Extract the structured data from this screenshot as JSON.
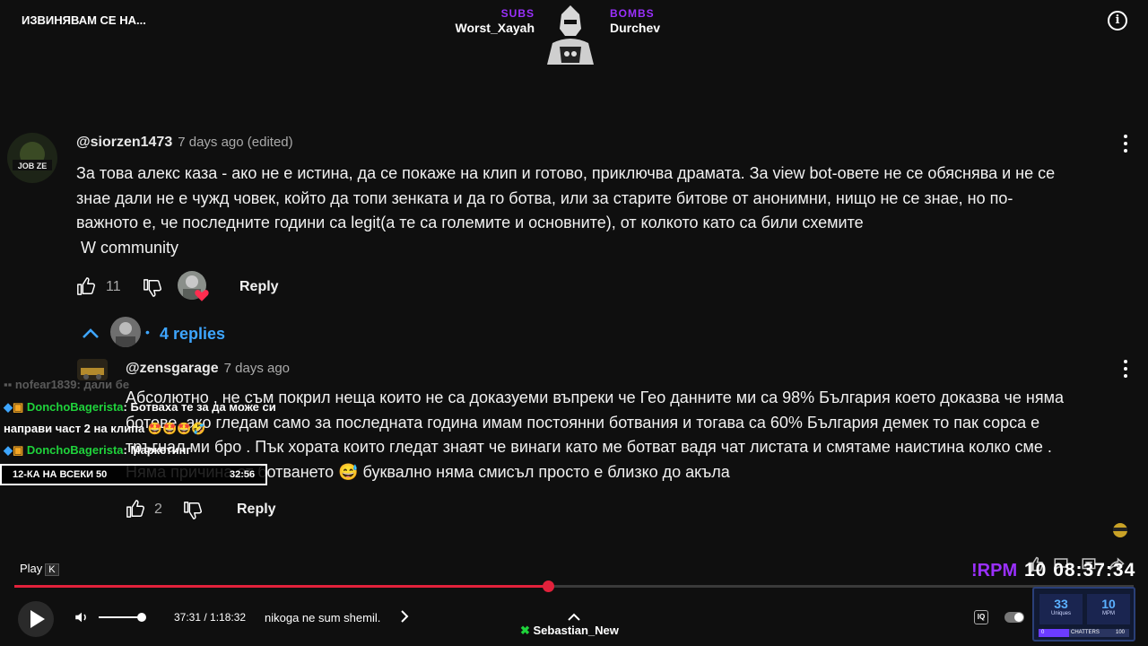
{
  "overlay": {
    "stream_title": "ИЗВИНЯВАМ СЕ НА...",
    "subs_label": "SUBS",
    "subs_name": "Worst_Xayah",
    "bombs_label": "BOMBS",
    "bombs_name": "Durchev",
    "rpm_label": "!RPM",
    "clock": "10 08:37:34",
    "box_label": "12-КА НА ВСЕКИ 50",
    "box_value": "32:56",
    "colors": {
      "accent_purple": "#9b30ff",
      "chat_green": "#1fd33b",
      "progress_red": "#e2213b",
      "link_blue": "#3ea6ff"
    }
  },
  "comments": [
    {
      "author": "@siorzen1473",
      "time": "7 days ago (edited)",
      "avatar_text": "JOB ZE",
      "lines": [
        "За това алекс каза - ако не е истина, да се покаже на клип и готово, приключва драмата. За view bot-овете не се обяснява и не се",
        "знае дали не е чужд човек, който да топи зенката и да го ботва, или за старите битове от анонимни, нищо не се знае, но по-",
        "важното е, че последните години са legit(а те са големите и основните), от колкото като са били схемите",
        " W community"
      ],
      "likes": "11",
      "reply_label": "Reply",
      "replies_label": "4 replies"
    },
    {
      "author": "@zensgarage",
      "time": "7 days ago",
      "lines": [
        "Абсолютно , не съм покрил неща които не са доказуеми въпреки че Гео данните ми са 98% България което доказва че няма",
        "ботове. ако гледам само за последната година имам постоянни ботвания и тогава са 60% България демек то пак сорса е",
        "тръгнал ми брo . Пък хората които гледат знаят че винаги като ме ботват вадя чат листата  и смятаме наистина колко сме .",
        "Няма причина от ботването 😅 буквално няма смисъл просто е близко до акъла"
      ],
      "likes": "2",
      "reply_label": "Reply"
    }
  ],
  "chat": [
    {
      "user": "nofear1839",
      "text": ": дали бе",
      "faded": true
    },
    {
      "user": "DonchoBagerista",
      "text": ": Ботваха те за да може си",
      "faded": false
    },
    {
      "user": "",
      "text": "направи част 2 на клипа 🤩🤩🤩🤣",
      "faded": false
    },
    {
      "user": "DonchoBagerista",
      "text": ": Маркетинг",
      "faded": false
    }
  ],
  "player": {
    "play_tooltip": "Play",
    "play_key": "K",
    "time_display": "37:31 / 1:18:32",
    "chapter": "nikoga ne sum shemil.",
    "progress": 0.477,
    "volume": 1.0,
    "now_playing_user": "Sebastian_New"
  },
  "stats": {
    "uniques_value": "33",
    "uniques_label": "Uniques",
    "mpm_value": "10",
    "mpm_label": "MPM",
    "chatters_min": "0",
    "chatters_label": "CHATTERS",
    "chatters_max": "100"
  }
}
